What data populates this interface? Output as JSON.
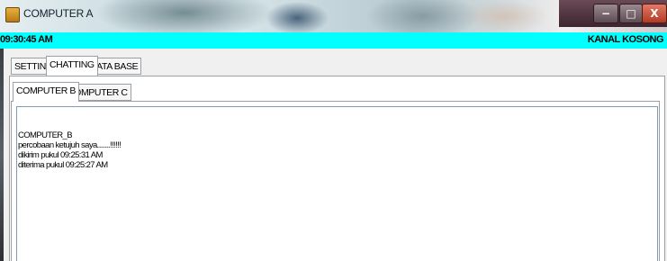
{
  "window": {
    "title": "COMPUTER A",
    "icon": "app-icon",
    "controls": {
      "minimize": "−",
      "maximize": "□",
      "close": "X"
    }
  },
  "status": {
    "time": "09:30:45 AM",
    "channel": "KANAL KOSONG",
    "bar_color": "#00ffff"
  },
  "main_tabs": [
    {
      "label": "SETTING",
      "active": false
    },
    {
      "label": "CHATTING",
      "active": true
    },
    {
      "label": "DATA BASE",
      "active": false
    }
  ],
  "sub_tabs": [
    {
      "label": "COMPUTER B",
      "active": true
    },
    {
      "label": "COMPUTER C",
      "active": false
    }
  ],
  "chat": {
    "lines": [
      "COMPUTER_B",
      "percobaan ketujuh saya.......!!!!!!",
      "dikirim pukul  09:25:31 AM",
      "diterima pukul 09:25:27 AM"
    ]
  }
}
